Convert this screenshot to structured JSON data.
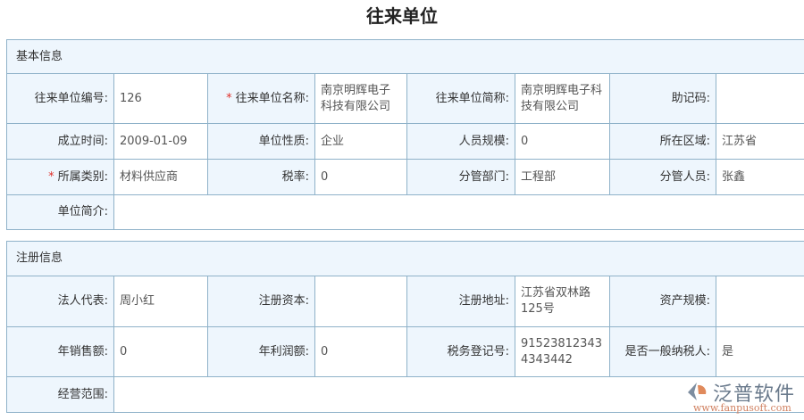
{
  "title": "往来单位",
  "basic": {
    "header": "基本信息",
    "rows": [
      [
        {
          "label": "往来单位编号:",
          "value": "126"
        },
        {
          "label": "往来单位名称:",
          "value": "南京明辉电子科技有限公司",
          "required": true
        },
        {
          "label": "往来单位简称:",
          "value": "南京明辉电子科技有限公司"
        },
        {
          "label": "助记码:",
          "value": ""
        }
      ],
      [
        {
          "label": "成立时间:",
          "value": "2009-01-09"
        },
        {
          "label": "单位性质:",
          "value": "企业"
        },
        {
          "label": "人员规模:",
          "value": "0"
        },
        {
          "label": "所在区域:",
          "value": "江苏省"
        }
      ],
      [
        {
          "label": "所属类别:",
          "value": "材料供应商",
          "required": true
        },
        {
          "label": "税率:",
          "value": "0"
        },
        {
          "label": "分管部门:",
          "value": "工程部"
        },
        {
          "label": "分管人员:",
          "value": "张鑫"
        }
      ]
    ],
    "intro": {
      "label": "单位简介:",
      "value": ""
    }
  },
  "reg": {
    "header": "注册信息",
    "rows": [
      [
        {
          "label": "法人代表:",
          "value": "周小红"
        },
        {
          "label": "注册资本:",
          "value": ""
        },
        {
          "label": "注册地址:",
          "value": "江苏省双林路125号"
        },
        {
          "label": "资产规模:",
          "value": ""
        }
      ],
      [
        {
          "label": "年销售额:",
          "value": "0"
        },
        {
          "label": "年利润额:",
          "value": "0"
        },
        {
          "label": "税务登记号:",
          "value": "915238123434343442"
        },
        {
          "label": "是否一般纳税人:",
          "value": "是"
        }
      ]
    ],
    "scope": {
      "label": "经营范围:",
      "value": ""
    }
  },
  "logo": {
    "name": "泛普软件",
    "url": "www.fanpusoft.com"
  }
}
